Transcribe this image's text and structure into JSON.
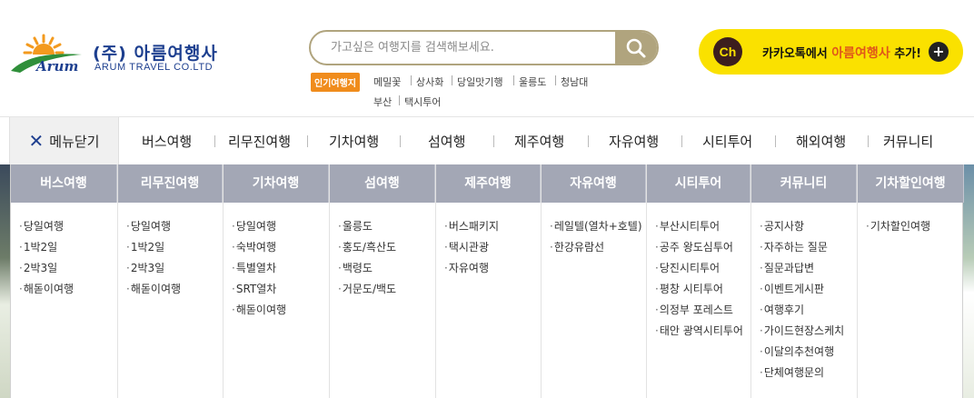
{
  "header": {
    "logo": {
      "brand_script": "Arum",
      "korean_name": "(주) 아름여행사",
      "english_name": "ARUM TRAVEL CO.LTD"
    },
    "search": {
      "placeholder": "가고싶은 여행지를 검색해보세요.",
      "value": ""
    },
    "popular": {
      "badge": "인기여행지",
      "keywords": [
        "메밀꽃",
        "상사화",
        "당일맛기행",
        "울릉도",
        "청남대",
        "부산",
        "택시투어"
      ]
    },
    "kakao": {
      "ch_label": "Ch",
      "text_prefix": "카카오톡에서 ",
      "text_highlight": "아름여행사",
      "text_suffix": " 추가!",
      "plus": "+"
    }
  },
  "nav": {
    "close_label": "메뉴닫기",
    "close_icon": "✕",
    "items": [
      "버스여행",
      "리무진여행",
      "기차여행",
      "섬여행",
      "제주여행",
      "자유여행",
      "시티투어",
      "해외여행",
      "커뮤니티"
    ]
  },
  "mega_menu": {
    "columns": [
      {
        "title": "버스여행",
        "items": [
          "당일여행",
          "1박2일",
          "2박3일",
          "해돋이여행"
        ]
      },
      {
        "title": "리무진여행",
        "items": [
          "당일여행",
          "1박2일",
          "2박3일",
          "해돋이여행"
        ]
      },
      {
        "title": "기차여행",
        "items": [
          "당일여행",
          "숙박여행",
          "특별열차",
          "SRT열차",
          "해돋이여행"
        ]
      },
      {
        "title": "섬여행",
        "items": [
          "울릉도",
          "홍도/흑산도",
          "백령도",
          "거문도/백도"
        ]
      },
      {
        "title": "제주여행",
        "items": [
          "버스패키지",
          "택시관광",
          "자유여행"
        ]
      },
      {
        "title": "자유여행",
        "items": [
          "레일텔(열차+호텔)",
          "한강유람선"
        ]
      },
      {
        "title": "시티투어",
        "items": [
          "부산시티투어",
          "공주 왕도심투어",
          "당진시티투어",
          "평창 시티투어",
          "의정부 포레스트",
          "태안 광역시티투어"
        ]
      },
      {
        "title": "커뮤니티",
        "items": [
          "공지사항",
          "자주하는 질문",
          "질문과답변",
          "이벤트게시판",
          "여행후기",
          "가이드현장스케치",
          "이달의추천여행",
          "단체여행문의"
        ]
      },
      {
        "title": "기차할인여행",
        "items": [
          "기차할인여행"
        ]
      }
    ]
  },
  "colors": {
    "brand_navy": "#1d3f8f",
    "search_gold": "#b0a47e",
    "badge_orange": "#f08c1c",
    "kakao_yellow": "#fae100",
    "mega_header_gray": "#a3a7b5"
  }
}
